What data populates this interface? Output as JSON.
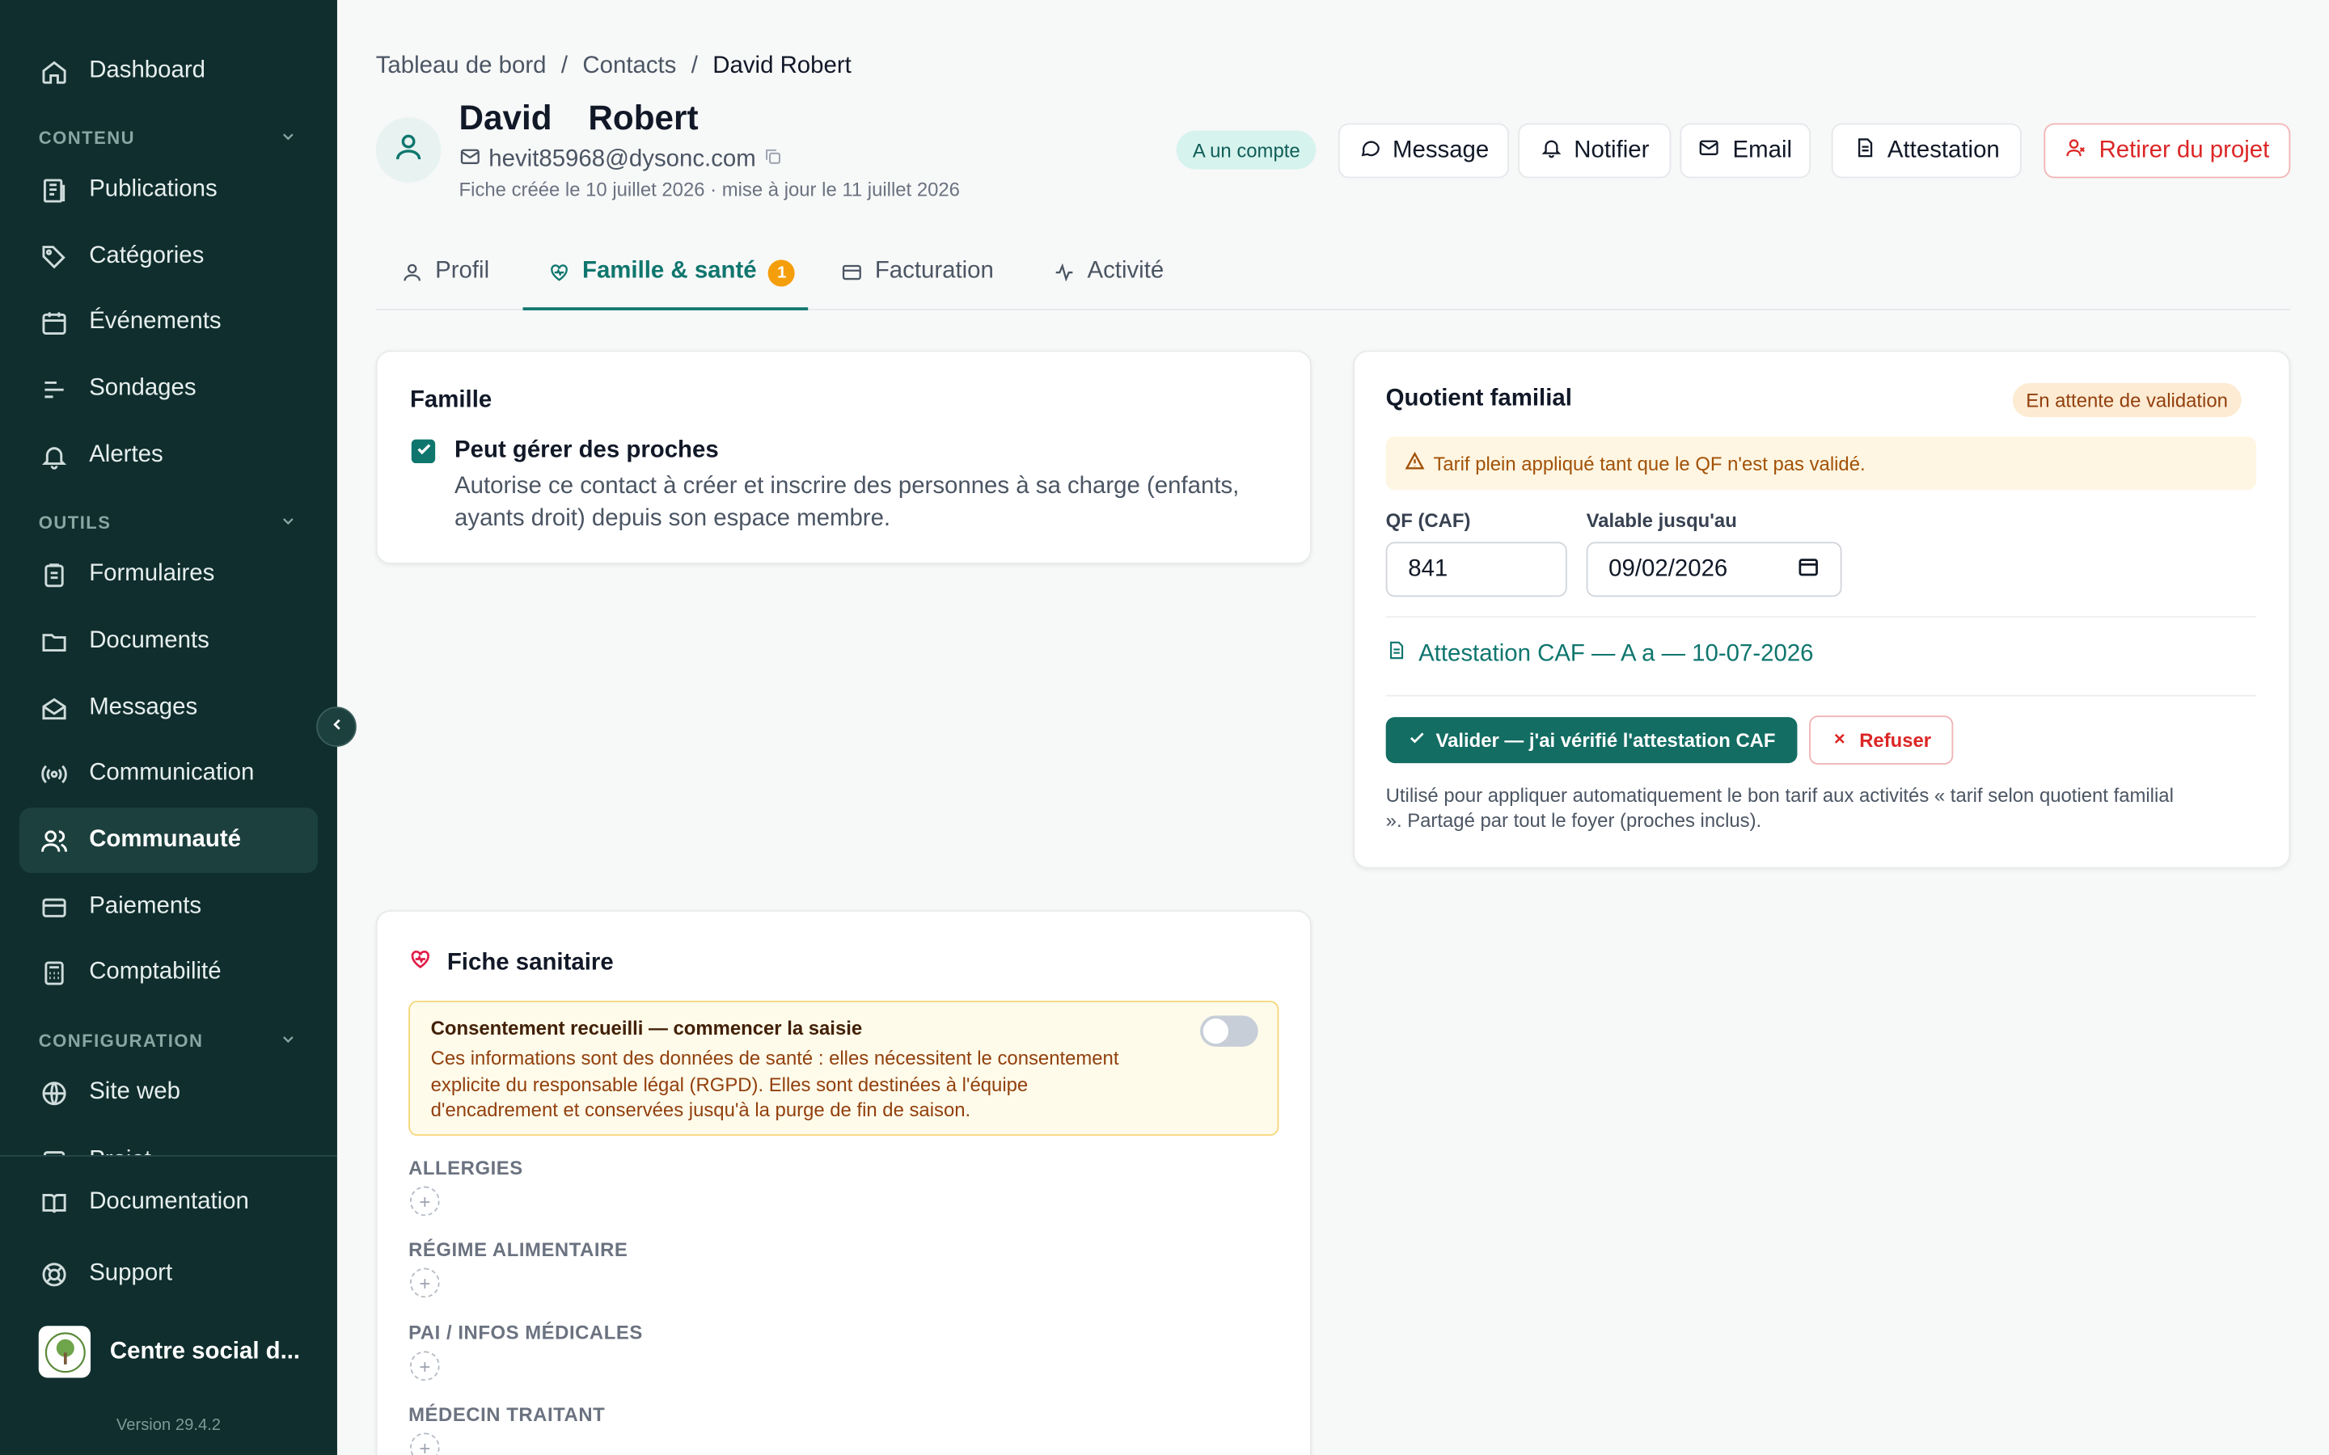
{
  "sidebar": {
    "dashboard": "Dashboard",
    "sections": {
      "contenu": "CONTENU",
      "outils": "OUTILS",
      "configuration": "CONFIGURATION"
    },
    "items": {
      "publications": "Publications",
      "categories": "Catégories",
      "evenements": "Événements",
      "sondages": "Sondages",
      "alertes": "Alertes",
      "formulaires": "Formulaires",
      "documents": "Documents",
      "messages": "Messages",
      "communication": "Communication",
      "communaute": "Communauté",
      "paiements": "Paiements",
      "comptabilite": "Comptabilité",
      "site_web": "Site web",
      "projet": "Projet"
    },
    "documentation": "Documentation",
    "support": "Support",
    "org_name": "Centre social d...",
    "version": "Version 29.4.2"
  },
  "breadcrumb": {
    "home": "Tableau de bord",
    "sep": "/",
    "contacts": "Contacts",
    "current": "David Robert"
  },
  "contact": {
    "name": "David  Robert",
    "email": "hevit85968@dysonc.com",
    "meta": "Fiche créée le 10 juillet 2026 · mise à jour le 11 juillet 2026",
    "account_badge": "A un compte"
  },
  "actions": {
    "message": "Message",
    "notifier": "Notifier",
    "email": "Email",
    "attestation": "Attestation",
    "retirer": "Retirer du projet"
  },
  "tabs": {
    "profil": "Profil",
    "famille": "Famille & santé",
    "famille_count": "1",
    "facturation": "Facturation",
    "activite": "Activité"
  },
  "famille": {
    "title": "Famille",
    "checkbox_label": "Peut gérer des proches",
    "checkbox_checked": true,
    "help_line1": "Autorise ce contact à créer et inscrire des personnes à sa charge (enfants,",
    "help_line2": "ayants droit) depuis son espace membre."
  },
  "qf": {
    "title": "Quotient familial",
    "status": "En attente de validation",
    "warning": "Tarif plein appliqué tant que le QF n'est pas validé.",
    "qf_label": "QF (CAF)",
    "qf_value": "841",
    "valid_label": "Valable jusqu'au",
    "valid_value": "09/02/2026",
    "attestation_link": "Attestation CAF — A a — 10-07-2026",
    "validate_btn": "Valider — j'ai vérifié l'attestation CAF",
    "refuse_btn": "Refuser",
    "help_line1": "Utilisé pour appliquer automatiquement le bon tarif aux activités « tarif selon quotient familial",
    "help_line2": "». Partagé par tout le foyer (proches inclus)."
  },
  "sanitaire": {
    "title": "Fiche sanitaire",
    "consent_title": "Consentement recueilli — commencer la saisie",
    "consent_line1": "Ces informations sont des données de santé : elles nécessitent le consentement",
    "consent_line2": "explicite du responsable légal (RGPD). Elles sont destinées à l'équipe",
    "consent_line3": "d'encadrement et conservées jusqu'à la purge de fin de saison.",
    "consent_enabled": false,
    "allergies": "ALLERGIES",
    "regime": "RÉGIME ALIMENTAIRE",
    "pai": "PAI / INFOS MÉDICALES",
    "medecin": "MÉDECIN TRAITANT"
  },
  "colors": {
    "sidebar_bg": "#0f2e2d",
    "accent": "#0f766e",
    "danger": "#dc2626",
    "warning": "#f59e0b"
  }
}
